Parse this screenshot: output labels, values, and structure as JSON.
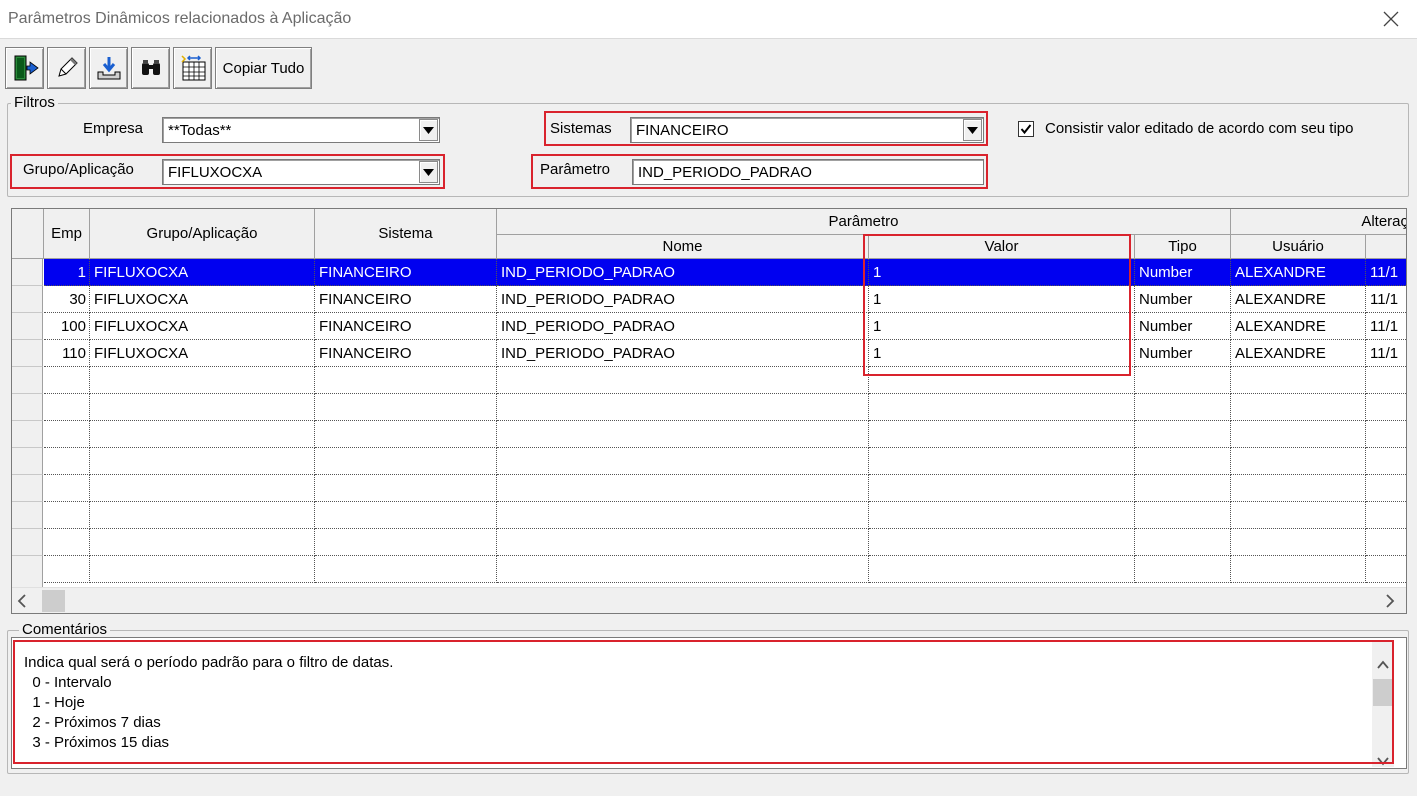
{
  "window": {
    "title": "Parâmetros Dinâmicos relacionados à Aplicação"
  },
  "toolbar": {
    "copy_label": "Copiar Tudo"
  },
  "filters": {
    "legend": "Filtros",
    "empresa_label": "Empresa",
    "empresa_value": "**Todas**",
    "sistemas_label": "Sistemas",
    "sistemas_value": "FINANCEIRO",
    "grupo_label": "Grupo/Aplicação",
    "grupo_value": "FIFLUXOCXA",
    "parametro_label": "Parâmetro",
    "parametro_value": "IND_PERIODO_PADRAO",
    "consistir_label": "Consistir valor editado de acordo com seu tipo",
    "consistir_checked": true
  },
  "grid": {
    "headers": {
      "emp": "Emp",
      "grupo": "Grupo/Aplicação",
      "sistema": "Sistema",
      "parametro": "Parâmetro",
      "nome": "Nome",
      "valor": "Valor",
      "tipo": "Tipo",
      "alteracao": "Alteraç",
      "usuario": "Usuário"
    },
    "rows": [
      {
        "emp": "1",
        "grupo": "FIFLUXOCXA",
        "sistema": "FINANCEIRO",
        "nome": "IND_PERIODO_PADRAO",
        "valor": "1",
        "tipo": "Number",
        "usuario": "ALEXANDRE",
        "data": "11/1"
      },
      {
        "emp": "30",
        "grupo": "FIFLUXOCXA",
        "sistema": "FINANCEIRO",
        "nome": "IND_PERIODO_PADRAO",
        "valor": "1",
        "tipo": "Number",
        "usuario": "ALEXANDRE",
        "data": "11/1"
      },
      {
        "emp": "100",
        "grupo": "FIFLUXOCXA",
        "sistema": "FINANCEIRO",
        "nome": "IND_PERIODO_PADRAO",
        "valor": "1",
        "tipo": "Number",
        "usuario": "ALEXANDRE",
        "data": "11/1"
      },
      {
        "emp": "110",
        "grupo": "FIFLUXOCXA",
        "sistema": "FINANCEIRO",
        "nome": "IND_PERIODO_PADRAO",
        "valor": "1",
        "tipo": "Number",
        "usuario": "ALEXANDRE",
        "data": "11/1"
      }
    ]
  },
  "comments": {
    "legend": "Comentários",
    "lines": [
      "Indica qual será o período padrão para o filtro de datas.",
      "  0 - Intervalo",
      "  1 - Hoje",
      "  2 - Próximos 7 dias",
      "  3 - Próximos 15 dias"
    ]
  },
  "colors": {
    "highlight": "#d9232d",
    "selection": "#0000f0"
  }
}
